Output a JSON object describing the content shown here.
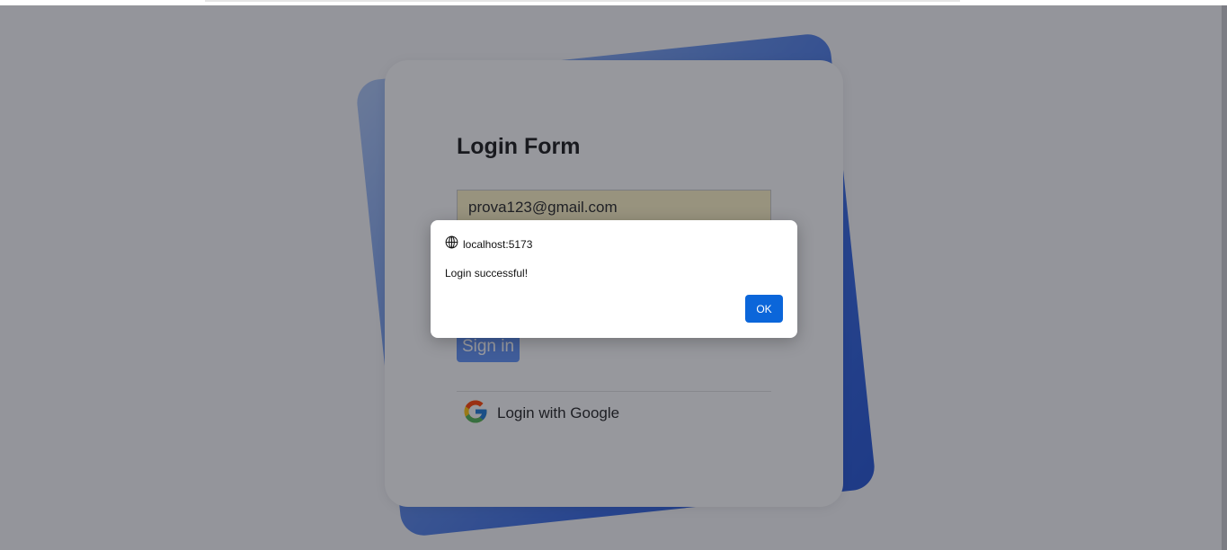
{
  "login_form": {
    "title": "Login Form",
    "email_value": "prova123@gmail.com",
    "signin_label": "Sign in",
    "google_label": "Login with Google"
  },
  "icons": {
    "google": "google-logo-icon",
    "origin": "globe-icon"
  },
  "dialog": {
    "origin": "localhost:5173",
    "message": "Login successful!",
    "ok_label": "OK"
  },
  "colors": {
    "accent_blue": "#0b66da",
    "signin_blue": "#5c8ef4",
    "autofill_yellow": "#fbf1c1",
    "card_gradient_end": "#1e4fcf"
  }
}
